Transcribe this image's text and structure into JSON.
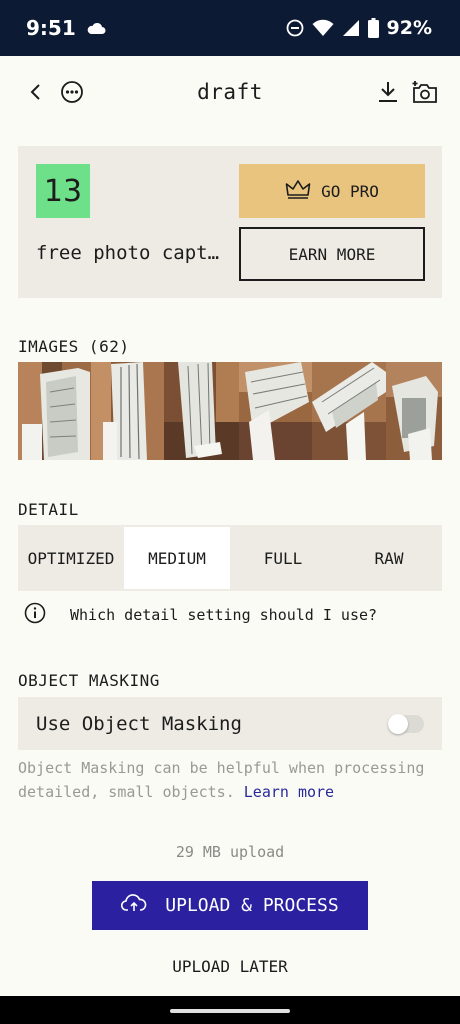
{
  "status_bar": {
    "time": "9:51",
    "battery": "92%",
    "icons": [
      "cloud-icon",
      "dnd-icon",
      "wifi-icon",
      "signal-icon",
      "battery-icon"
    ]
  },
  "app_bar": {
    "title": "draft",
    "icons": [
      "back-icon",
      "more-icon",
      "download-icon",
      "add-photo-icon"
    ]
  },
  "credits": {
    "count": "13",
    "label": "free photo captures",
    "go_pro": "GO PRO",
    "earn_more": "EARN MORE"
  },
  "images": {
    "label": "IMAGES (62)"
  },
  "detail": {
    "label": "DETAIL",
    "options": [
      "OPTIMIZED",
      "MEDIUM",
      "FULL",
      "RAW"
    ],
    "selected": "MEDIUM",
    "help": "Which detail setting should I use?"
  },
  "masking": {
    "label": "OBJECT MASKING",
    "toggle_label": "Use Object Masking",
    "enabled": false,
    "description": "Object Masking can be helpful when processing detailed, small objects.",
    "learn_more": "Learn more"
  },
  "upload": {
    "size": "29 MB upload",
    "process_button": "UPLOAD & PROCESS",
    "later_button": "UPLOAD LATER"
  },
  "colors": {
    "status_bar": "#0d1a33",
    "count_badge": "#6fe08a",
    "go_pro": "#e8c47f",
    "primary": "#2b20a0",
    "card_bg": "#edebe4"
  }
}
